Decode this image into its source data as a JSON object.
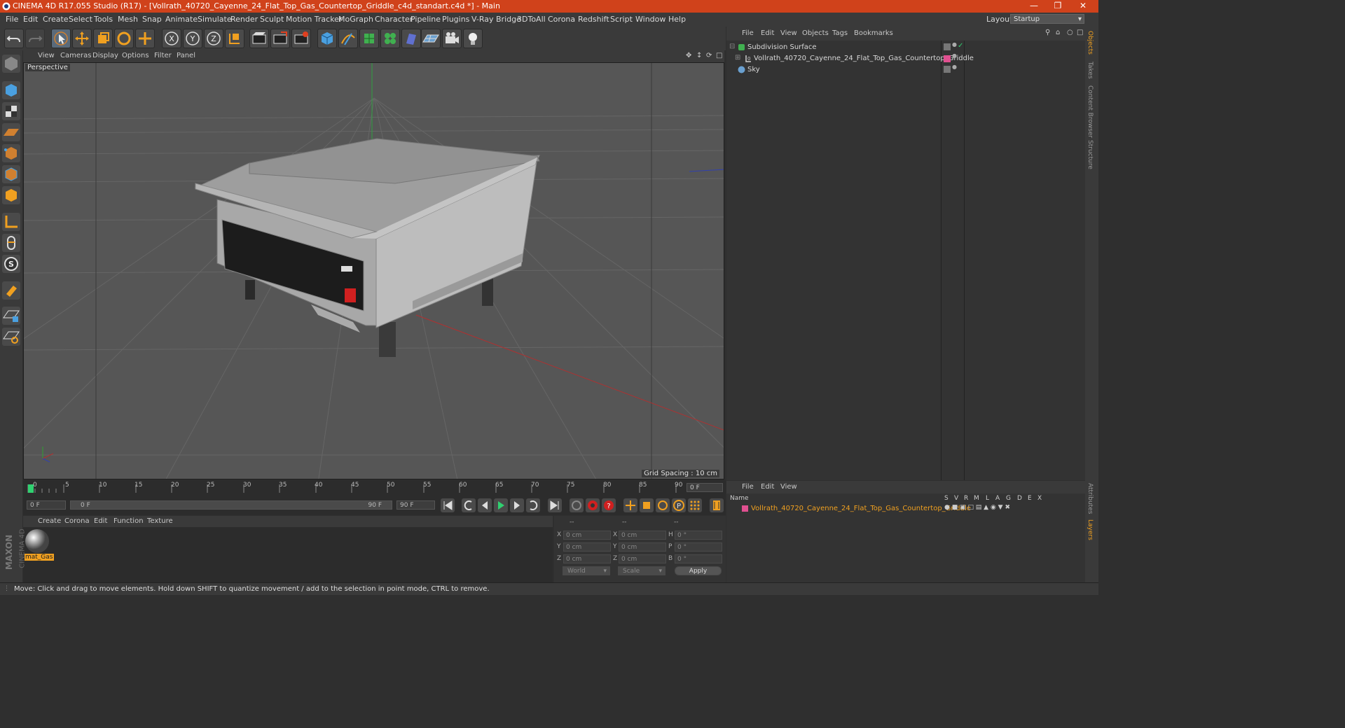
{
  "window": {
    "title": "CINEMA 4D R17.055 Studio (R17) - [Vollrath_40720_Cayenne_24_Flat_Top_Gas_Countertop_Griddle_c4d_standart.c4d *] - Main",
    "controls": [
      "minimize-icon",
      "restore-icon",
      "close-icon"
    ]
  },
  "menubar": {
    "items": [
      "File",
      "Edit",
      "Create",
      "Select",
      "Tools",
      "Mesh",
      "Snap",
      "Animate",
      "Simulate",
      "Render",
      "Sculpt",
      "Motion Tracker",
      "MoGraph",
      "Character",
      "Pipeline",
      "Plugins",
      "V-Ray Bridge",
      "3DToAll",
      "Corona",
      "Redshift",
      "Script",
      "Window",
      "Help"
    ],
    "layout_label": "Layout:",
    "layout_value": "Startup"
  },
  "toolbar": {
    "icons": [
      "undo-icon",
      "redo-icon",
      "live-selection-icon",
      "move-icon",
      "scale-icon",
      "rotate-icon",
      "recent-tools-icon",
      "x-axis-icon",
      "y-axis-icon",
      "z-axis-icon",
      "coordinate-system-icon",
      "render-view-icon",
      "render-picture-viewer-icon",
      "edit-render-settings-icon",
      "cube-primitive-icon",
      "pen-spline-icon",
      "subdivision-surface-icon",
      "cloner-icon",
      "deformer-icon",
      "floor-icon",
      "camera-icon",
      "light-icon"
    ],
    "axis_labels": [
      "X",
      "Y",
      "Z"
    ]
  },
  "left_palette": {
    "icons": [
      "make-editable-icon",
      "model-mode-icon",
      "texture-mode-icon",
      "workplane-mode-icon",
      "points-mode-icon",
      "edges-mode-icon",
      "polygons-mode-icon",
      "axis-mode-icon",
      "tweak-mode-icon",
      "solo-mode-icon",
      "magnet-icon",
      "snap-workplane-icon",
      "snap-settings-icon"
    ],
    "solo_label": "S"
  },
  "viewport": {
    "menu": [
      "View",
      "Cameras",
      "Display",
      "Options",
      "Filter",
      "Panel"
    ],
    "label": "Perspective",
    "grid_spacing": "Grid Spacing : 10 cm",
    "colors": {
      "background": "#565656",
      "grid": "#6a6a6a",
      "x_axis": "#b03030",
      "y_axis": "#30a030",
      "z_axis": "#3040b0"
    }
  },
  "timeline": {
    "ticks": [
      "0",
      "5",
      "10",
      "15",
      "20",
      "25",
      "30",
      "35",
      "40",
      "45",
      "50",
      "55",
      "60",
      "65",
      "70",
      "75",
      "80",
      "85",
      "90"
    ],
    "current_frame": "0 F",
    "start_field": "0 F",
    "range_start": "0 F",
    "range_end": "90 F",
    "end_field": "90 F",
    "playback_icons": [
      "go-to-start-icon",
      "previous-keyframe-icon",
      "play-backwards-icon",
      "play-forwards-icon",
      "next-keyframe-icon",
      "loop-icon",
      "go-to-end-icon"
    ],
    "key_icons": [
      "motion-record-icon",
      "record-active-icon",
      "autokeying-icon",
      "key-position-icon",
      "key-scale-icon",
      "key-rotation-icon",
      "key-parameter-icon",
      "key-pla-icon",
      "timeline-window-icon"
    ],
    "param_key_label": "P"
  },
  "material_manager": {
    "menu": [
      "Create",
      "Corona",
      "Edit",
      "Function",
      "Texture"
    ],
    "materials": [
      {
        "name": "mat_Gas"
      }
    ]
  },
  "coordinates": {
    "header": [
      "--",
      "--",
      "--"
    ],
    "rows": [
      {
        "l1": "X",
        "v1": "0 cm",
        "l2": "X",
        "v2": "0 cm",
        "l3": "H",
        "v3": "0 °"
      },
      {
        "l1": "Y",
        "v1": "0 cm",
        "l2": "Y",
        "v2": "0 cm",
        "l3": "P",
        "v3": "0 °"
      },
      {
        "l1": "Z",
        "v1": "0 cm",
        "l2": "Z",
        "v2": "0 cm",
        "l3": "B",
        "v3": "0 °"
      }
    ],
    "space": "World",
    "mode": "Scale",
    "apply": "Apply"
  },
  "object_manager": {
    "menu": [
      "File",
      "Edit",
      "View",
      "Objects",
      "Tags",
      "Bookmarks"
    ],
    "objects": [
      {
        "name": "Subdivision Surface",
        "icon": "subdivision-surface-icon"
      },
      {
        "name": "Vollrath_40720_Cayenne_24_Flat_Top_Gas_Countertop_Griddle",
        "icon": "null-object-icon"
      },
      {
        "name": "Sky",
        "icon": "sky-icon"
      }
    ]
  },
  "layer_manager": {
    "menu": [
      "File",
      "Edit",
      "View"
    ],
    "columns": [
      "Name",
      "S",
      "V",
      "R",
      "M",
      "L",
      "A",
      "G",
      "D",
      "E",
      "X"
    ],
    "layers": [
      {
        "name": "Vollrath_40720_Cayenne_24_Flat_Top_Gas_Countertop_Griddle",
        "color": "#e05090"
      }
    ]
  },
  "right_tabs": [
    "Objects",
    "Takes",
    "Content Browser",
    "Structure",
    "Attributes",
    "Layers"
  ],
  "status": "Move: Click and drag to move elements. Hold down SHIFT to quantize movement / add to the selection in point mode, CTRL to remove.",
  "brand": {
    "logo_text_1": "MAXON",
    "logo_text_2": "CINEMA 4D"
  },
  "accent": "#d0421b"
}
